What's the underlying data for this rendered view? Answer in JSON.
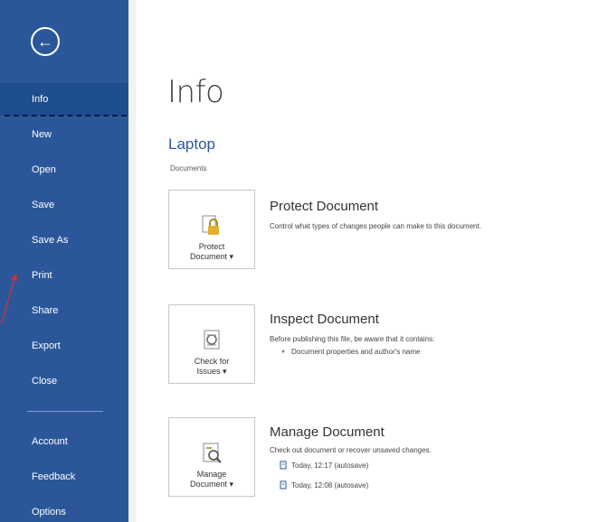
{
  "sidebar": {
    "back_glyph": "←",
    "items": [
      {
        "label": "Info"
      },
      {
        "label": "New"
      },
      {
        "label": "Open"
      },
      {
        "label": "Save"
      },
      {
        "label": "Save As"
      },
      {
        "label": "Print"
      },
      {
        "label": "Share"
      },
      {
        "label": "Export"
      },
      {
        "label": "Close"
      },
      {
        "label": "Account"
      },
      {
        "label": "Feedback"
      },
      {
        "label": "Options"
      }
    ]
  },
  "main": {
    "title": "Info",
    "location": "Laptop",
    "path": "Documents",
    "sections": [
      {
        "tile_label": "Protect\nDocument ▾",
        "title": "Protect Document",
        "description": "Control what types of changes people can make to this document."
      },
      {
        "tile_label": "Check for\nIssues ▾",
        "title": "Inspect Document",
        "description": "Before publishing this file, be aware that it contains:",
        "bullet": "Document properties and author's name"
      },
      {
        "tile_label": "Manage\nDocument ▾",
        "title": "Manage Document",
        "description": "Check out document or recover unsaved changes.",
        "versions": [
          {
            "text": "Today, 12:17 (autosave)"
          },
          {
            "text": "Today, 12:08 (autosave)"
          }
        ]
      }
    ]
  },
  "colors": {
    "sidebar": "#2b579a",
    "accent": "#2b579a"
  }
}
